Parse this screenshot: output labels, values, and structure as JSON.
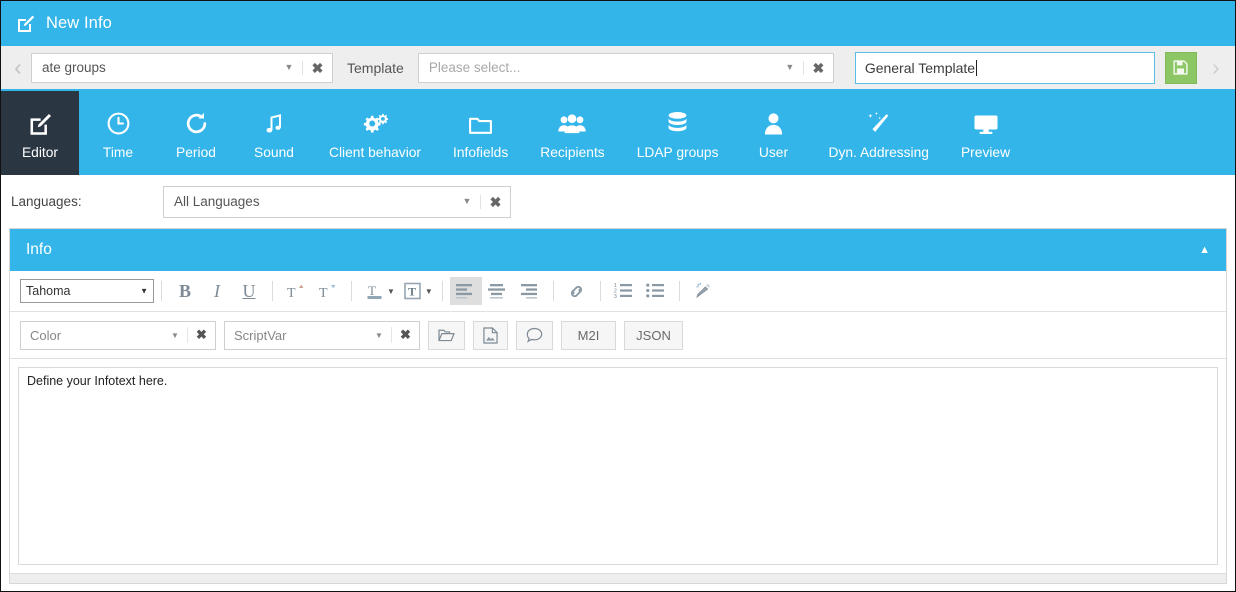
{
  "window": {
    "title": "New Info",
    "title_icon": "edit-square-icon"
  },
  "topbar": {
    "prev_arrow": "‹",
    "next_arrow": "›",
    "group_select": {
      "value": "ate groups",
      "caret": "▼",
      "clear": "✖"
    },
    "template_label": "Template",
    "template_select": {
      "placeholder": "Please select...",
      "caret": "▼",
      "clear": "✖"
    },
    "name_input": {
      "value": "General Template"
    },
    "save_button": {
      "icon": "floppy-disk-icon",
      "color": "#8cc665"
    }
  },
  "tabs": [
    {
      "label": "Editor",
      "icon": "edit-square-icon",
      "active": true
    },
    {
      "label": "Time",
      "icon": "clock-icon",
      "active": false
    },
    {
      "label": "Period",
      "icon": "refresh-icon",
      "active": false
    },
    {
      "label": "Sound",
      "icon": "music-note-icon",
      "active": false
    },
    {
      "label": "Client behavior",
      "icon": "gears-icon",
      "active": false
    },
    {
      "label": "Infofields",
      "icon": "folder-icon",
      "active": false
    },
    {
      "label": "Recipients",
      "icon": "users-icon",
      "active": false
    },
    {
      "label": "LDAP groups",
      "icon": "database-icon",
      "active": false
    },
    {
      "label": "User",
      "icon": "user-icon",
      "active": false
    },
    {
      "label": "Dyn. Addressing",
      "icon": "magic-wand-icon",
      "active": false
    },
    {
      "label": "Preview",
      "icon": "monitor-icon",
      "active": false
    }
  ],
  "languages": {
    "label": "Languages:",
    "value": "All Languages",
    "caret": "▼",
    "clear": "✖"
  },
  "info_panel": {
    "title": "Info",
    "collapse_chevron": "▲"
  },
  "editor": {
    "font_family": "Tahoma",
    "font_caret": "▼",
    "toolbar_row1": [
      {
        "name": "bold-button",
        "glyph": "B",
        "active": false
      },
      {
        "name": "italic-button",
        "glyph": "I",
        "active": false
      },
      {
        "name": "underline-button",
        "glyph": "U",
        "active": false
      },
      {
        "name": "superscript-button",
        "glyph": "T",
        "active": false
      },
      {
        "name": "subscript-button",
        "glyph": "T",
        "active": false
      },
      {
        "name": "text-color-button",
        "glyph": "T",
        "active": false
      },
      {
        "name": "background-color-button",
        "glyph": "T",
        "active": false
      },
      {
        "name": "align-left-button",
        "glyph": "",
        "active": true
      },
      {
        "name": "align-center-button",
        "glyph": "",
        "active": false
      },
      {
        "name": "align-right-button",
        "glyph": "",
        "active": false
      },
      {
        "name": "insert-link-button",
        "glyph": "",
        "active": false
      },
      {
        "name": "numbered-list-button",
        "glyph": "",
        "active": false
      },
      {
        "name": "bullet-list-button",
        "glyph": "",
        "active": false
      },
      {
        "name": "remove-format-button",
        "glyph": "",
        "active": false
      }
    ],
    "color_select": {
      "value": "Color",
      "caret": "▼",
      "clear": "✖"
    },
    "scriptvar_select": {
      "value": "ScriptVar",
      "caret": "▼",
      "clear": "✖"
    },
    "buttons": [
      {
        "name": "open-file-button",
        "label": "",
        "icon": "open-folder-icon"
      },
      {
        "name": "insert-image-button",
        "label": "",
        "icon": "image-file-icon"
      },
      {
        "name": "comment-button",
        "label": "",
        "icon": "speech-bubble-icon"
      },
      {
        "name": "m2i-button",
        "label": "M2I",
        "icon": ""
      },
      {
        "name": "json-button",
        "label": "JSON",
        "icon": ""
      }
    ],
    "content": "Define your Infotext here."
  },
  "colors": {
    "accent_blue": "#33b5e9",
    "dark_tab": "#2b3643",
    "save_green": "#8cc665"
  }
}
